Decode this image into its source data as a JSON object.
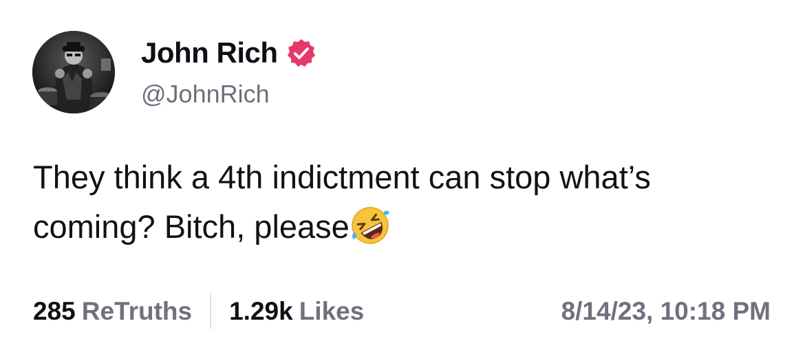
{
  "author": {
    "display_name": "John Rich",
    "handle": "@JohnRich",
    "avatar_icon": "avatar-photo",
    "verified_icon": "verified-badge-icon",
    "verified_color": "#e8386b"
  },
  "post": {
    "text": "They think a 4th indictment can stop what’s coming? Bitch, please",
    "emoji": "rolling-on-the-floor-laughing-emoji"
  },
  "stats": {
    "retruths_count": "285",
    "retruths_label": "ReTruths",
    "likes_count": "1.29k",
    "likes_label": "Likes"
  },
  "timestamp": "8/14/23, 10:18 PM"
}
